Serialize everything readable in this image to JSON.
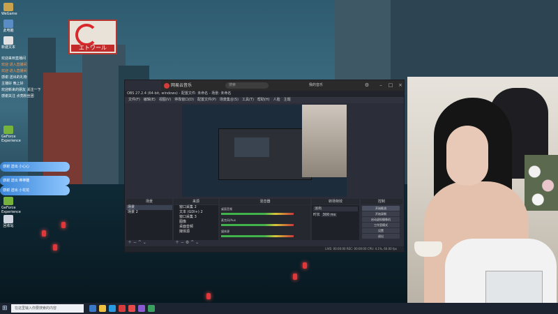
{
  "desktop": {
    "icons": [
      {
        "label": "WeGame",
        "color": "#c8a24c"
      },
      {
        "label": "此电脑",
        "color": "#5a8cc6"
      },
      {
        "label": "新建文本",
        "color": "#e2e2e2"
      },
      {
        "label": "GeForce Experience",
        "color": "#75b33a"
      },
      {
        "label": "GeForce Experience",
        "color": "#75b33a"
      },
      {
        "label": "回收站",
        "color": "#cfd6df"
      }
    ],
    "sign": {
      "text": "エトワール"
    }
  },
  "chat": {
    "lines": [
      "欢迎来到直播间",
      "欢迎 进入直播间",
      "欢迎 进入直播间",
      "感谢 送出的礼物",
      "主播好 晚上好",
      "欢迎新来的朋友 关注一下",
      "感谢关注 点亮粉丝团"
    ],
    "gifts": [
      "感谢 送出 小心心",
      "感谢 送出 棒棒糖",
      "感谢 送出 小花花"
    ]
  },
  "music_window": {
    "app_name": "网易云音乐",
    "search_placeholder": "搜索",
    "user": "我的音乐"
  },
  "obs": {
    "title": "OBS 27.2.4 (64-bit, windows) - 配置文件: 未命名 - 场景: 未命名",
    "menu": [
      "文件(F)",
      "编辑(E)",
      "视图(V)",
      "停靠窗口(D)",
      "配置文件(P)",
      "场景集合(S)",
      "工具(T)",
      "帮助(H)",
      "人脸",
      "主题"
    ],
    "panels": {
      "scenes": "场景",
      "sources": "来源",
      "mixer": "混音器",
      "transitions": "转场特效",
      "controls": "控制"
    },
    "scenes": [
      "场景",
      "场景 2"
    ],
    "sources": [
      "窗口采集 2",
      "文本 (GDI+) 2",
      "窗口采集 3",
      "图像",
      "桌面音频",
      "媒体源"
    ],
    "mixer": [
      "桌面音频",
      "麦克风/Aux",
      "媒体源"
    ],
    "transition": {
      "type": "淡出",
      "duration_label": "时长",
      "duration": "300 ms"
    },
    "controls": [
      "开始推流",
      "开始录制",
      "启动虚拟摄像机",
      "工作室模式",
      "设置",
      "退出"
    ],
    "status": "LIVE: 00:00:00  REC: 00:00:00  CPU: 4.1%, 60.00 fps"
  },
  "taskbar": {
    "search_placeholder": "在这里输入你要搜索的内容",
    "icons": [
      "#3a78c8",
      "#f0c040",
      "#2a9ae0",
      "#d83b3b",
      "#e84a4a",
      "#8a5ad0",
      "#3aa060"
    ]
  }
}
